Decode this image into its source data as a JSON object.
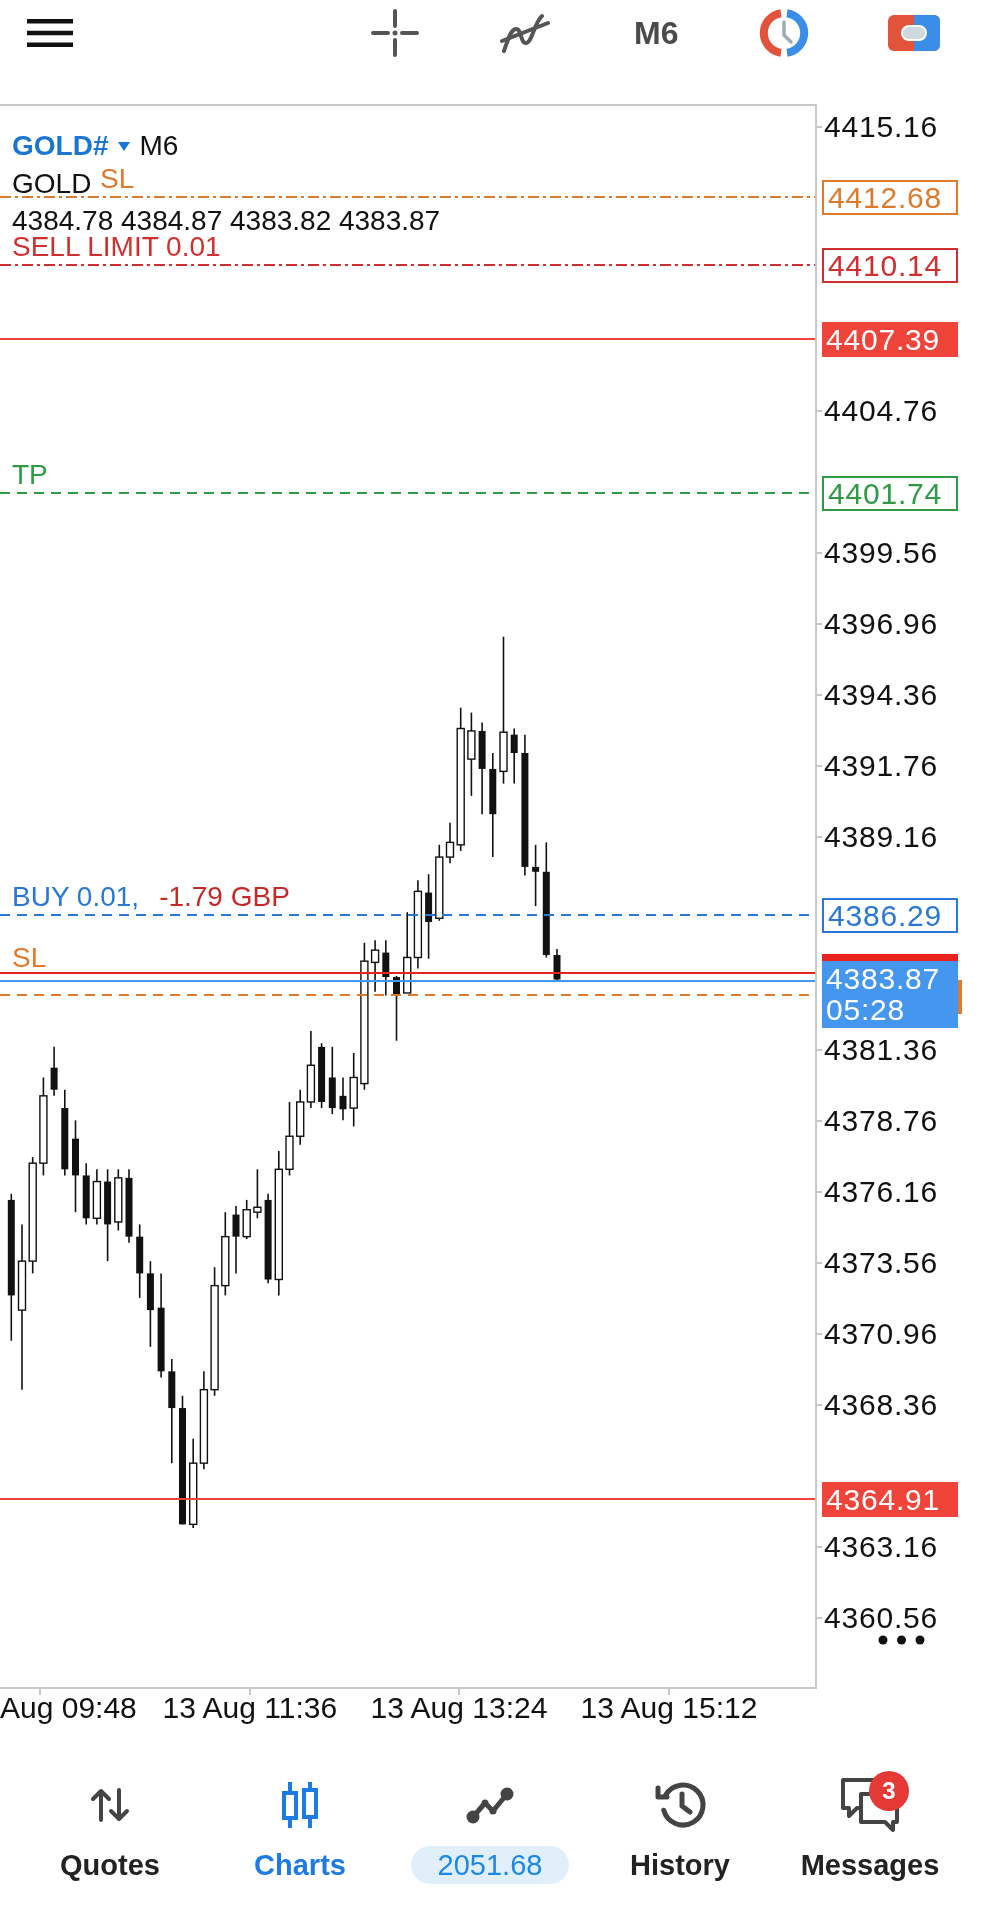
{
  "toolbar": {
    "timeframe": "M6"
  },
  "chart": {
    "symbol": "GOLD#",
    "timeframe": "M6",
    "description": "GOLD",
    "ohlc": "4384.78 4384.87 4383.82 4383.87",
    "lines": [
      {
        "kind": "stop_loss",
        "pending": true,
        "label": "SL",
        "price": "4412.68",
        "color": "#dd7a2c"
      },
      {
        "kind": "order",
        "pending": true,
        "label": "SELL LIMIT 0.01",
        "price": "4410.14",
        "color": "#d12f2f"
      },
      {
        "kind": "level",
        "pending": false,
        "price": "4407.39",
        "color": "#f0443a"
      },
      {
        "kind": "take_profit",
        "pending": false,
        "label": "TP",
        "price": "4401.74",
        "color": "#2e9a44"
      },
      {
        "kind": "order",
        "pending": false,
        "label": "BUY 0.01,",
        "profit": "-1.79 GBP",
        "price": "4386.29",
        "color": "#2a78d6"
      },
      {
        "kind": "ask",
        "pending": false,
        "color": "#e8221c"
      },
      {
        "kind": "stop_loss",
        "pending": false,
        "label": "SL",
        "color": "#dd7a2c"
      },
      {
        "kind": "bid",
        "pending": false,
        "price": "4383.87",
        "countdown": "05:28",
        "color": "#4596ef"
      },
      {
        "kind": "level",
        "pending": false,
        "price": "4364.91",
        "color": "#f0443a"
      }
    ],
    "price_ticks": [
      "4415.16",
      "4404.76",
      "4399.56",
      "4396.96",
      "4394.36",
      "4391.76",
      "4389.16",
      "4381.36",
      "4378.76",
      "4376.16",
      "4373.56",
      "4370.96",
      "4368.36",
      "4363.16",
      "4360.56"
    ],
    "time_ticks": [
      "Aug 09:48",
      "13 Aug 11:36",
      "13 Aug 13:24",
      "13 Aug 15:12"
    ]
  },
  "bottom_nav": [
    {
      "kind": "tab",
      "label": "Quotes",
      "selected": false
    },
    {
      "kind": "tab",
      "label": "Charts",
      "selected": true
    },
    {
      "kind": "balance",
      "label": "2051.68",
      "selected": false
    },
    {
      "kind": "tab",
      "label": "History",
      "selected": false
    },
    {
      "kind": "tab",
      "label": "Messages",
      "selected": false,
      "badge": "3"
    }
  ]
}
